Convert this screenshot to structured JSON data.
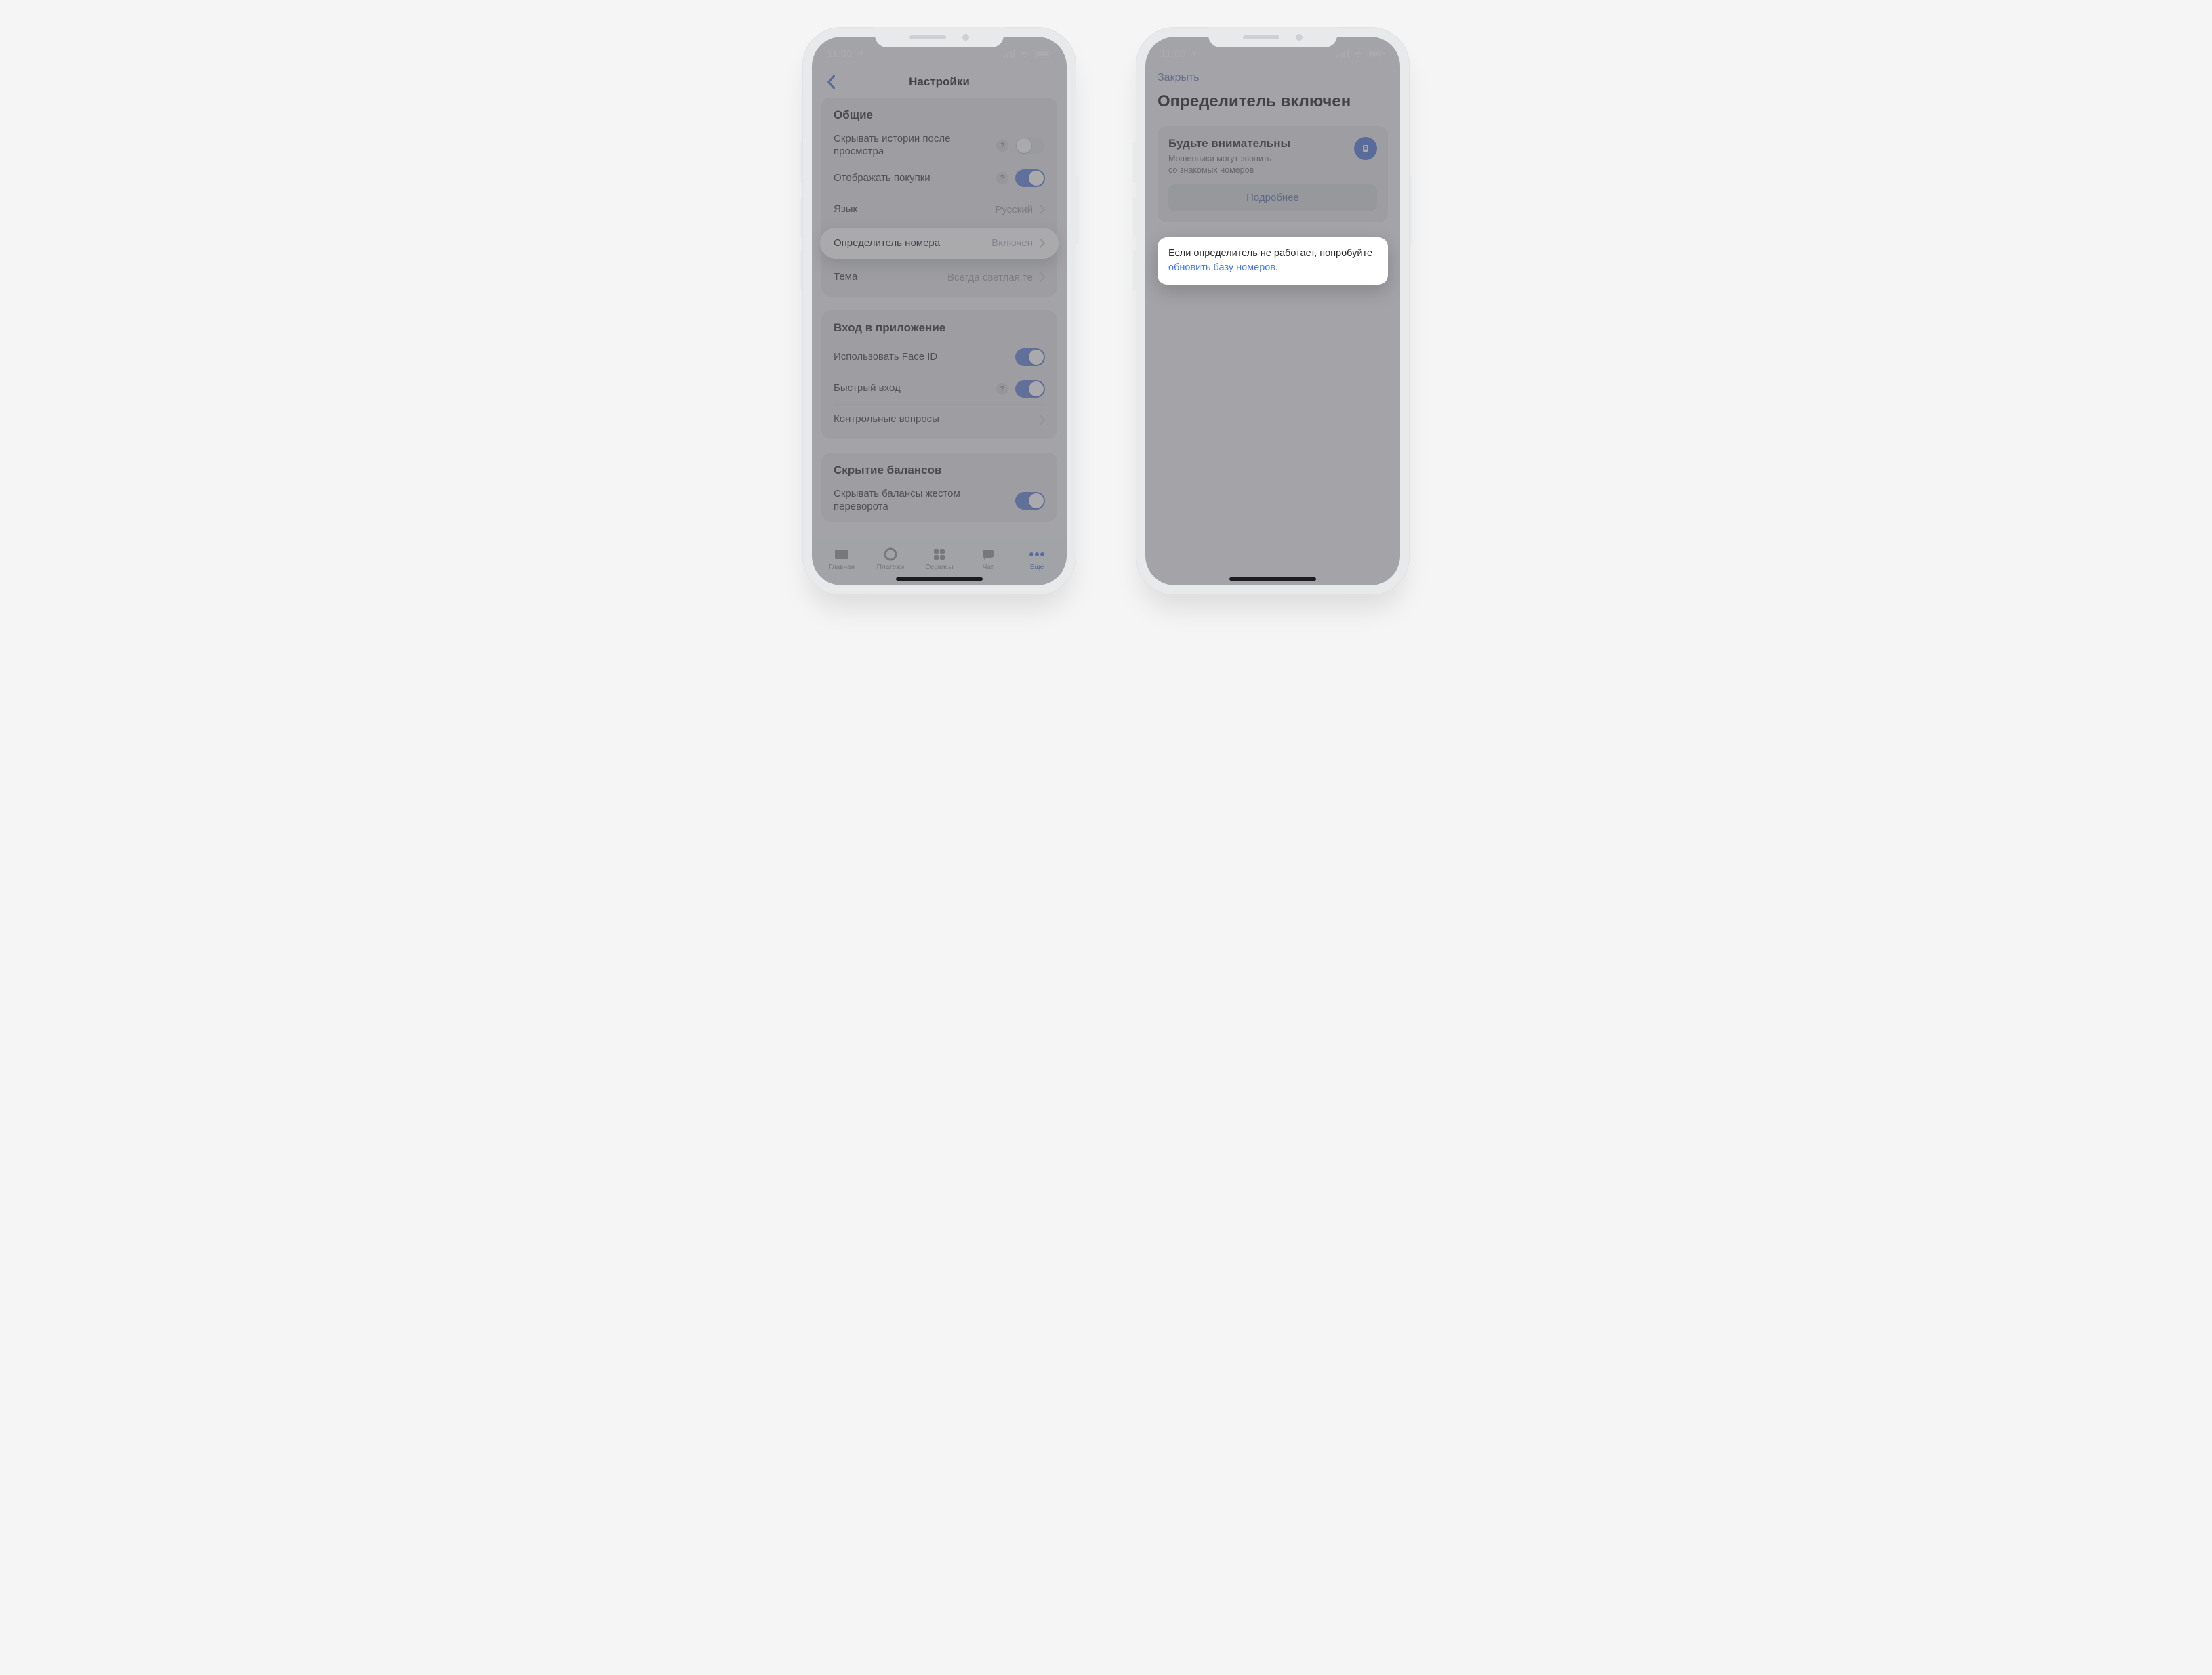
{
  "status": {
    "time": "11:00"
  },
  "phone1": {
    "nav_title": "Настройки",
    "sections": {
      "general": {
        "title": "Общие",
        "hide_stories": "Скрывать истории после просмотра",
        "show_purchases": "Отображать покупки",
        "language_label": "Язык",
        "language_value": "Русский",
        "caller_id_label": "Определитель номера",
        "caller_id_value": "Включен",
        "theme_label": "Тема",
        "theme_value": "Всегда светлая те"
      },
      "login": {
        "title": "Вход в приложение",
        "faceid": "Использовать Face ID",
        "quick": "Быстрый вход",
        "questions": "Контрольные вопросы"
      },
      "balances": {
        "title": "Скрытие балансов",
        "gesture": "Скрывать балансы жестом переворота"
      }
    },
    "tabs": {
      "home": "Главная",
      "payments": "Платежи",
      "services": "Сервисы",
      "chat": "Чат",
      "more": "Еще"
    }
  },
  "phone2": {
    "close": "Закрыть",
    "title": "Определитель включен",
    "notice": {
      "title": "Будьте внимательны",
      "sub1": "Мошенники могут звонить",
      "sub2": "со знакомых номеров",
      "more": "Подробнее"
    },
    "hint": {
      "text_before": "Если определитель не работает, попробуйте ",
      "link": "обновить базу номеров",
      "text_after": "."
    }
  },
  "help_glyph": "?"
}
